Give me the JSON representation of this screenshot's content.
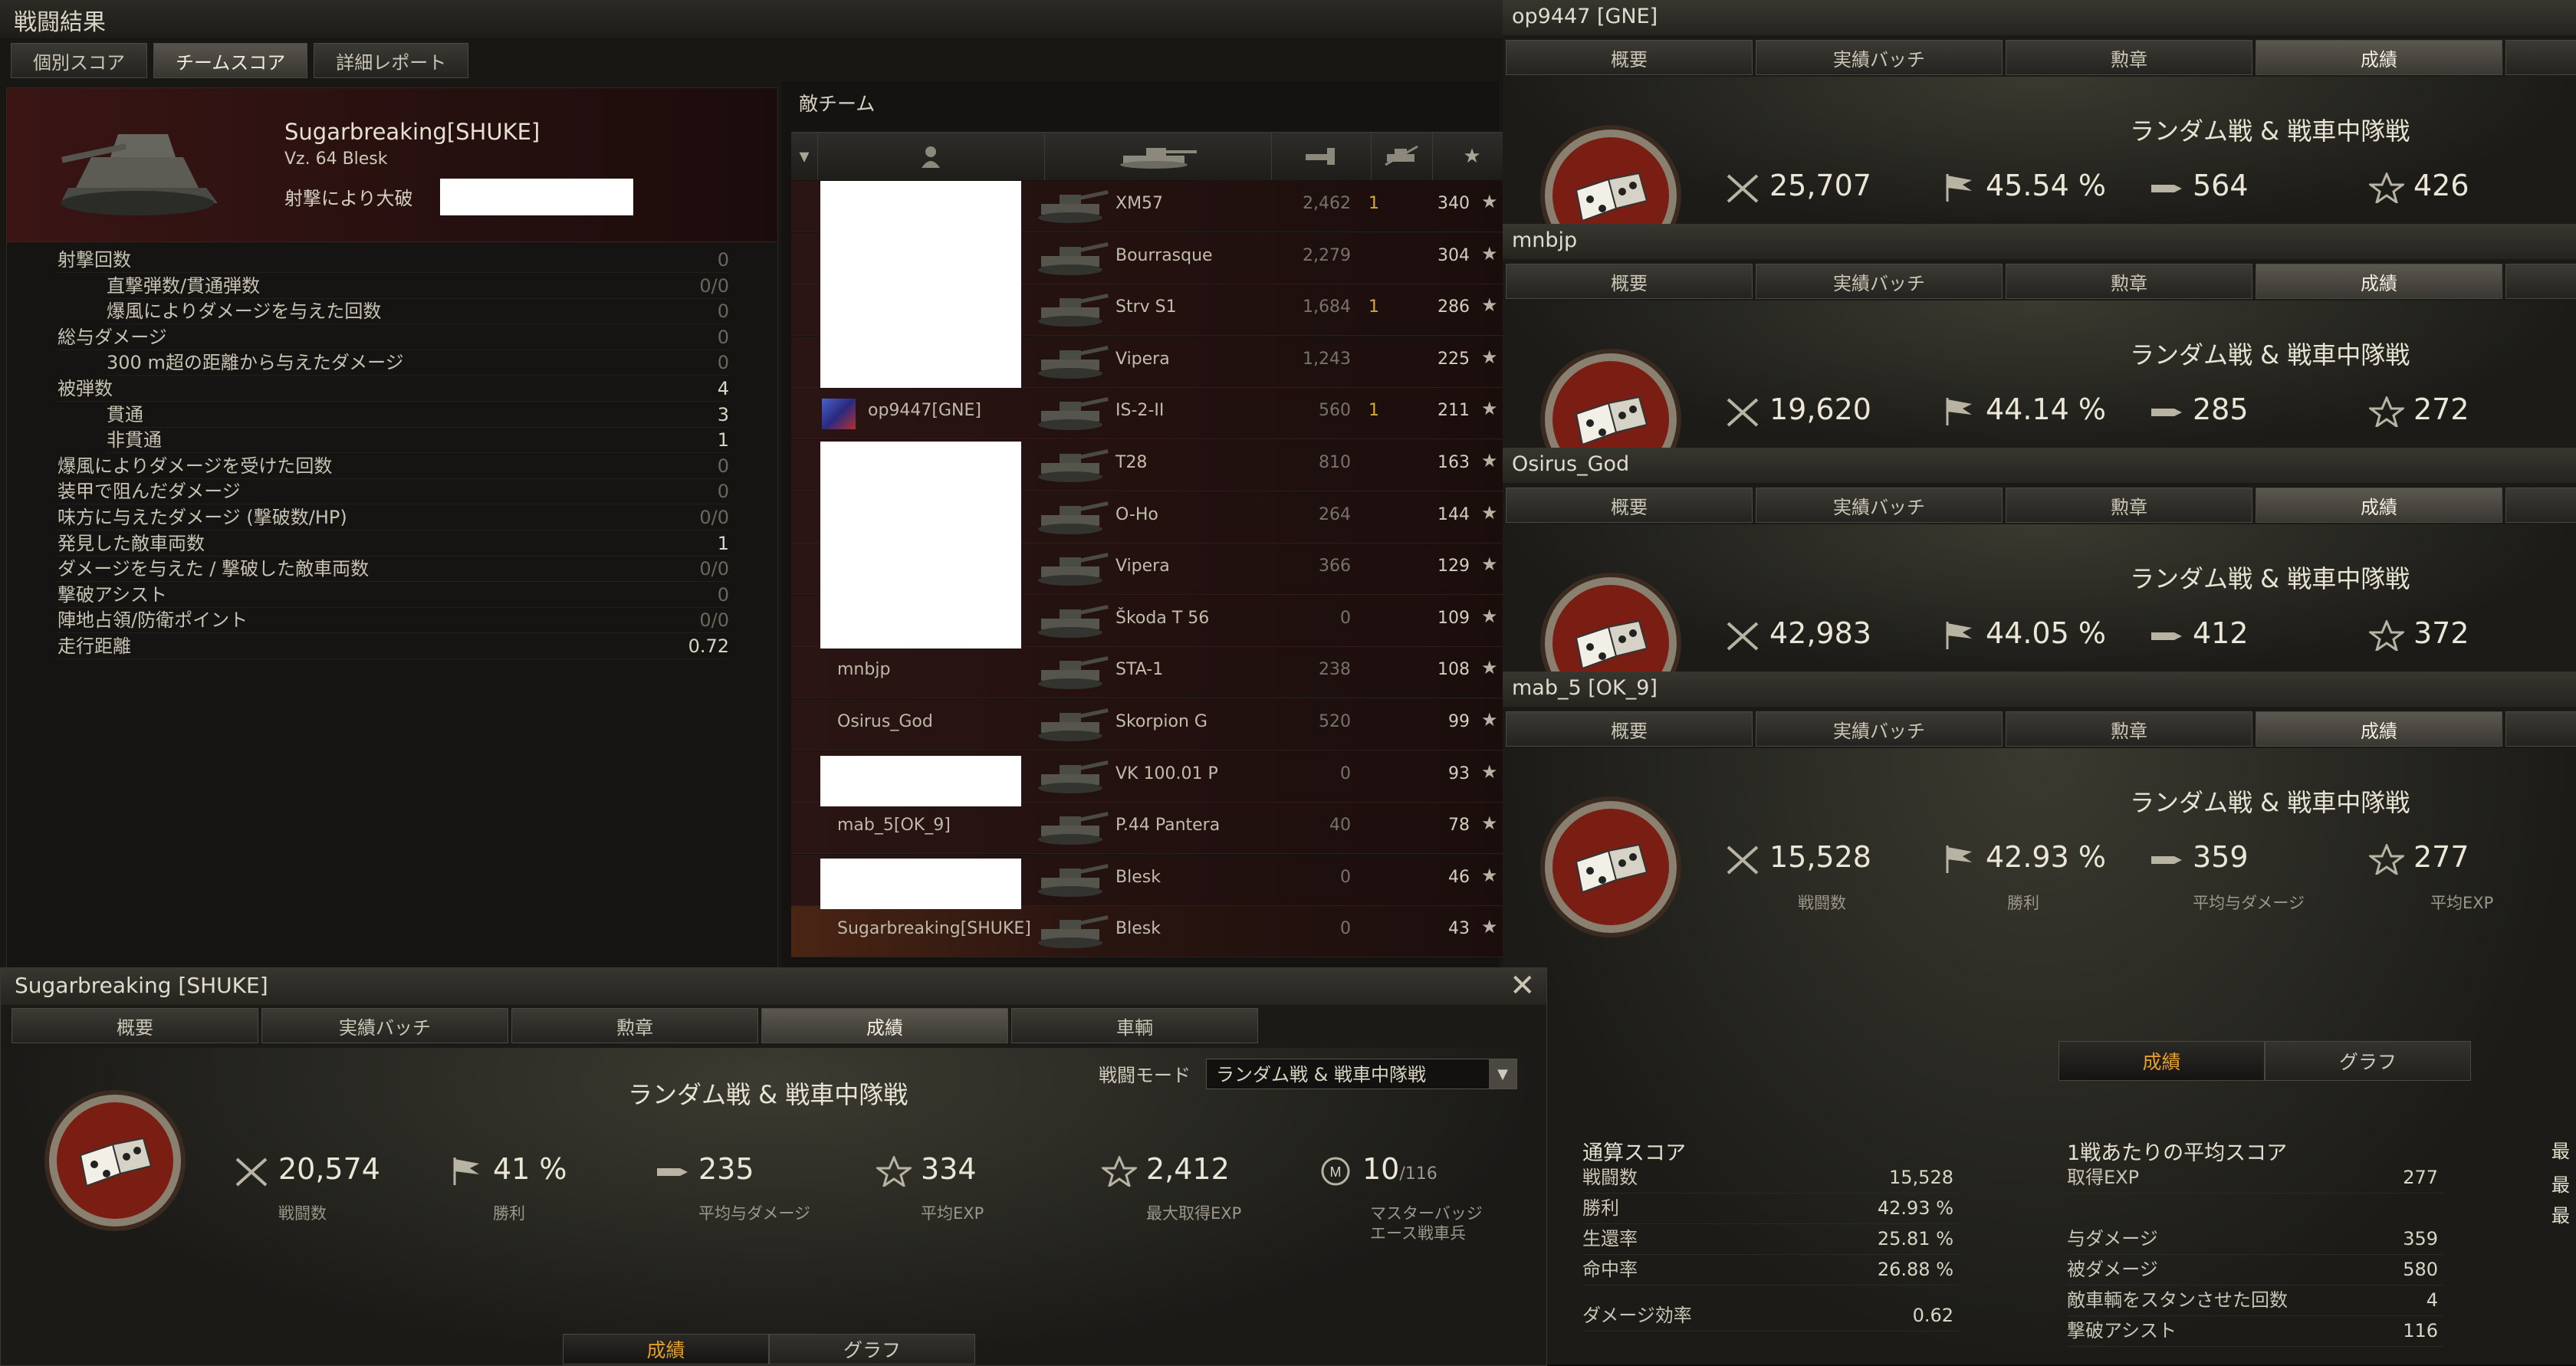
{
  "window": {
    "title": "戦闘結果"
  },
  "tabs": [
    "個別スコア",
    "チームスコア",
    "詳細レポート"
  ],
  "player": {
    "name": "Sugarbreaking[SHUKE]",
    "tank": "Vz. 64 Blesk",
    "kill_label": "射撃により大破"
  },
  "stats": [
    {
      "label": "射撃回数",
      "value": "0",
      "sub": false,
      "hi": false
    },
    {
      "label": "直撃弾数/貫通弾数",
      "value": "0/0",
      "sub": true,
      "hi": false
    },
    {
      "label": "爆風によりダメージを与えた回数",
      "value": "0",
      "sub": true,
      "hi": false
    },
    {
      "label": "総与ダメージ",
      "value": "0",
      "sub": false,
      "hi": false
    },
    {
      "label": "300 m超の距離から与えたダメージ",
      "value": "0",
      "sub": true,
      "hi": false
    },
    {
      "label": "被弾数",
      "value": "4",
      "sub": false,
      "hi": true
    },
    {
      "label": "貫通",
      "value": "3",
      "sub": true,
      "hi": true
    },
    {
      "label": "非貫通",
      "value": "1",
      "sub": true,
      "hi": true
    },
    {
      "label": "爆風によりダメージを受けた回数",
      "value": "0",
      "sub": false,
      "hi": false
    },
    {
      "label": "装甲で阻んだダメージ",
      "value": "0",
      "sub": false,
      "hi": false
    },
    {
      "label": "味方に与えたダメージ (撃破数/HP)",
      "value": "0/0",
      "sub": false,
      "hi": false
    },
    {
      "label": "発見した敵車両数",
      "value": "1",
      "sub": false,
      "hi": true
    },
    {
      "label": "ダメージを与えた / 撃破した敵車両数",
      "value": "0/0",
      "sub": false,
      "hi": false
    },
    {
      "label": "撃破アシスト",
      "value": "0",
      "sub": false,
      "hi": false
    },
    {
      "label": "陣地占領/防衛ポイント",
      "value": "0/0",
      "sub": false,
      "hi": false
    },
    {
      "label": "走行距離",
      "value": "0.72",
      "sub": false,
      "hi": true
    }
  ],
  "team": {
    "title": "敵チーム",
    "rows": [
      {
        "player": "",
        "tank": "XM57",
        "damage": "2,462",
        "kills": "1",
        "xp": "340"
      },
      {
        "player": "",
        "tank": "Bourrasque",
        "damage": "2,279",
        "kills": "",
        "xp": "304"
      },
      {
        "player": "",
        "tank": "Strv S1",
        "damage": "1,684",
        "kills": "1",
        "xp": "286"
      },
      {
        "player": "",
        "tank": "Vipera",
        "damage": "1,243",
        "kills": "",
        "xp": "225"
      },
      {
        "player": "op9447[GNE]",
        "tank": "IS-2-II",
        "damage": "560",
        "kills": "1",
        "xp": "211"
      },
      {
        "player": "",
        "tank": "T28",
        "damage": "810",
        "kills": "",
        "xp": "163"
      },
      {
        "player": "",
        "tank": "O-Ho",
        "damage": "264",
        "kills": "",
        "xp": "144"
      },
      {
        "player": "",
        "tank": "Vipera",
        "damage": "366",
        "kills": "",
        "xp": "129"
      },
      {
        "player": "",
        "tank": "Škoda T 56",
        "damage": "0",
        "kills": "",
        "xp": "109"
      },
      {
        "player": "mnbjp",
        "tank": "STA-1",
        "damage": "238",
        "kills": "",
        "xp": "108"
      },
      {
        "player": "Osirus_God",
        "tank": "Skorpion G",
        "damage": "520",
        "kills": "",
        "xp": "99"
      },
      {
        "player": "",
        "tank": "VK 100.01 P",
        "damage": "0",
        "kills": "",
        "xp": "93"
      },
      {
        "player": "mab_5[OK_9]",
        "tank": "P.44 Pantera",
        "damage": "40",
        "kills": "",
        "xp": "78"
      },
      {
        "player": "",
        "tank": "Blesk",
        "damage": "0",
        "kills": "",
        "xp": "46"
      },
      {
        "player": "Sugarbreaking[SHUKE]",
        "tank": "Blesk",
        "damage": "0",
        "kills": "",
        "xp": "43"
      }
    ]
  },
  "rtabs": [
    "概要",
    "実績バッチ",
    "勲章",
    "成績"
  ],
  "mode_label": "ランダム戦 & 戦車中隊戦",
  "panels": [
    {
      "name": "op9447 [GNE]",
      "battles": "25,707",
      "win": "45.54 %",
      "dmg": "564",
      "exp": "426"
    },
    {
      "name": "mnbjp",
      "battles": "19,620",
      "win": "44.14 %",
      "dmg": "285",
      "exp": "272"
    },
    {
      "name": "Osirus_God",
      "battles": "42,983",
      "win": "44.05 %",
      "dmg": "412",
      "exp": "372"
    },
    {
      "name": "mab_5 [OK_9]",
      "battles": "15,528",
      "win": "42.93 %",
      "dmg": "359",
      "exp": "277"
    }
  ],
  "caps": {
    "battles": "戦闘数",
    "win": "勝利",
    "dmg": "平均与ダメージ",
    "exp": "平均EXP",
    "maxexp": "最大取得EXP",
    "master": "マスターバッジ",
    "ace": "エース戦車兵"
  },
  "graph_tabs": [
    "成績",
    "グラフ"
  ],
  "overall": {
    "title": "通算スコア",
    "rows": [
      {
        "k": "戦闘数",
        "v": "15,528"
      },
      {
        "k": "勝利",
        "v": "42.93 %"
      },
      {
        "k": "生還率",
        "v": "25.81 %"
      },
      {
        "k": "命中率",
        "v": "26.88 %"
      },
      {
        "k": "ダメージ効率",
        "v": "0.62"
      }
    ]
  },
  "avg": {
    "title": "1戦あたりの平均スコア",
    "rows": [
      {
        "k": "取得EXP",
        "v": "277"
      },
      {
        "k": "与ダメージ",
        "v": "359"
      },
      {
        "k": "被ダメージ",
        "v": "580"
      },
      {
        "k": "敵車輌をスタンさせた回数",
        "v": "4"
      },
      {
        "k": "撃破アシスト",
        "v": "116"
      }
    ],
    "right_frag": [
      "最",
      "最",
      "最"
    ]
  },
  "profile": {
    "name": "Sugarbreaking [SHUKE]",
    "tabs": [
      "概要",
      "実績バッチ",
      "勲章",
      "成績",
      "車輌"
    ],
    "battle_mode_label": "戦闘モード",
    "battle_mode": "ランダム戦 & 戦車中隊戦",
    "battles": "20,574",
    "win": "41 %",
    "dmg": "235",
    "exp": "334",
    "maxexp": "2,412",
    "master": "10",
    "master_total": "/116"
  }
}
